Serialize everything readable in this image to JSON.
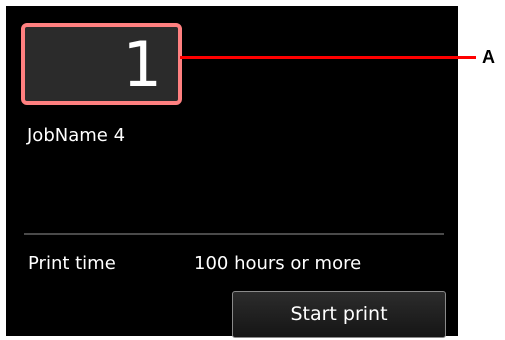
{
  "display": {
    "copies": "1",
    "job_name": "JobName 4",
    "print_time_label": "Print time",
    "print_time_value": "100 hours or more",
    "start_button_label": "Start print"
  },
  "callout": {
    "label": "A",
    "color": "#ff0000"
  },
  "colors": {
    "highlight_border": "#ff8080",
    "screen_background": "#000000"
  }
}
